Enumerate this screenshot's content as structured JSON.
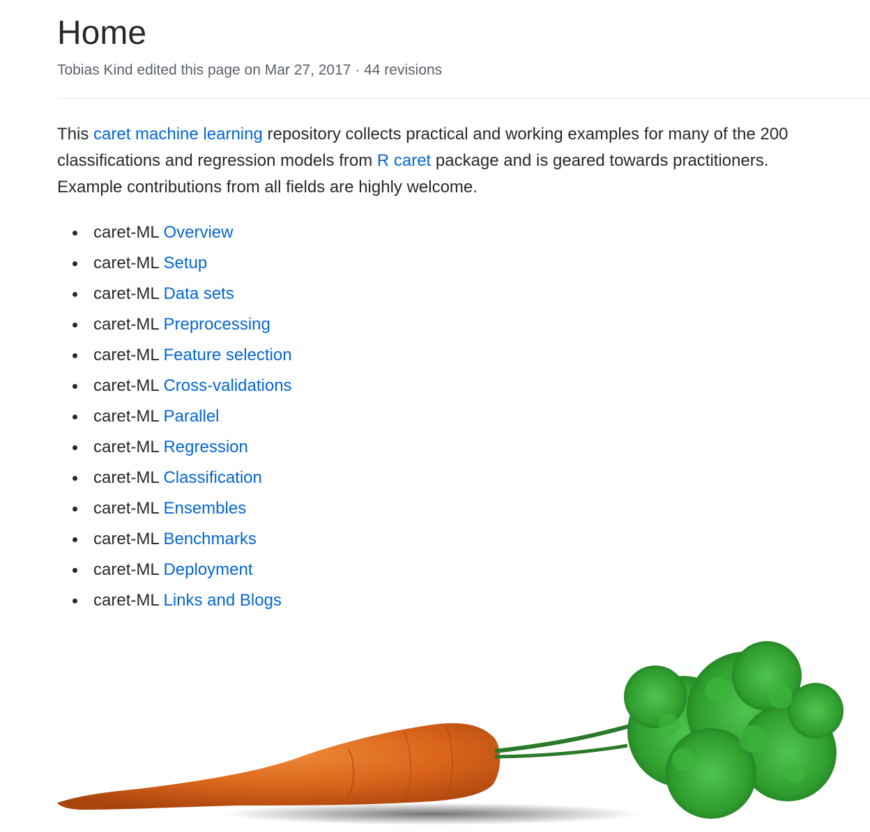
{
  "header": {
    "title": "Home",
    "meta": "Tobias Kind edited this page on Mar 27, 2017 · 44 revisions"
  },
  "intro": {
    "text_1": "This ",
    "link_1": "caret machine learning",
    "text_2": " repository collects practical and working examples for many of the 200 classifications and regression models from ",
    "link_2": "R caret",
    "text_3": " package and is geared towards practitioners. Example contributions from all fields are highly welcome."
  },
  "list": {
    "prefix": "caret-ML",
    "items": [
      {
        "label": "Overview"
      },
      {
        "label": "Setup"
      },
      {
        "label": "Data sets"
      },
      {
        "label": "Preprocessing"
      },
      {
        "label": "Feature selection"
      },
      {
        "label": "Cross-validations"
      },
      {
        "label": "Parallel"
      },
      {
        "label": "Regression"
      },
      {
        "label": "Classification"
      },
      {
        "label": "Ensembles"
      },
      {
        "label": "Benchmarks"
      },
      {
        "label": "Deployment"
      },
      {
        "label": "Links and Blogs"
      }
    ]
  },
  "colors": {
    "link": "#0366d6",
    "text": "#24292e",
    "muted": "#586069",
    "carrot": "#d9641a",
    "leaves": "#2f9e2f"
  }
}
